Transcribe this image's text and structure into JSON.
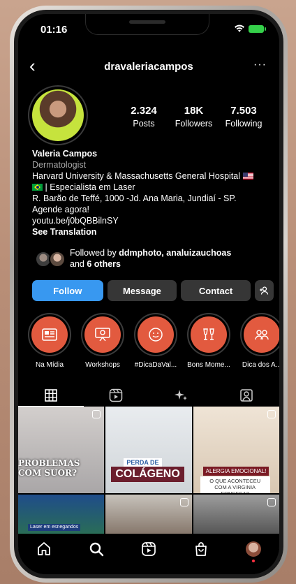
{
  "status": {
    "time": "01:16"
  },
  "header": {
    "username": "dravaleriacampos",
    "back_label": "‹",
    "more_label": "···"
  },
  "stats": [
    {
      "num": "2.324",
      "label": "Posts"
    },
    {
      "num": "18K",
      "label": "Followers"
    },
    {
      "num": "7.503",
      "label": "Following"
    }
  ],
  "bio": {
    "name": "Valeria Campos",
    "category": "Dermatologist",
    "line1": "Harvard University & Massachusetts General Hospital",
    "line2": "| Especialista em Laser",
    "line3": "R. Barão de Teffé, 1000 -Jd. Ana Maria, Jundiaí - SP.",
    "line4": "Agende agora!",
    "link": "youtu.be/j0bQBBilnSY",
    "translation": "See Translation"
  },
  "followed_by": {
    "prefix": "Followed by ",
    "names": "ddmphoto, analuizauchoas",
    "and": "and ",
    "others": "6 others"
  },
  "actions": {
    "follow": "Follow",
    "message": "Message",
    "contact": "Contact",
    "add_icon": "+"
  },
  "highlights": [
    {
      "label": "Na Mídia",
      "icon": "newspaper-icon"
    },
    {
      "label": "Workshops",
      "icon": "presentation-icon"
    },
    {
      "label": "#DicaDaVal...",
      "icon": "face-icon"
    },
    {
      "label": "Bons Mome...",
      "icon": "toast-icon"
    },
    {
      "label": "Dica dos A...",
      "icon": "group-icon"
    }
  ],
  "posts": [
    {
      "text": "PROBLEMAS\nCOM SUOR?"
    },
    {
      "small": "PERDA DE",
      "big": "COLÁGENO"
    },
    {
      "small": "ALERGIA EMOCIONAL!",
      "big": "O QUE ACONTECEU COM A VIRGINIA FONSECA?"
    },
    {
      "small": "Laser em esnegandos"
    },
    {},
    {}
  ],
  "colors": {
    "follow": "#3898f0",
    "highlight": "#e25a3f",
    "notify": "#ff3040"
  }
}
